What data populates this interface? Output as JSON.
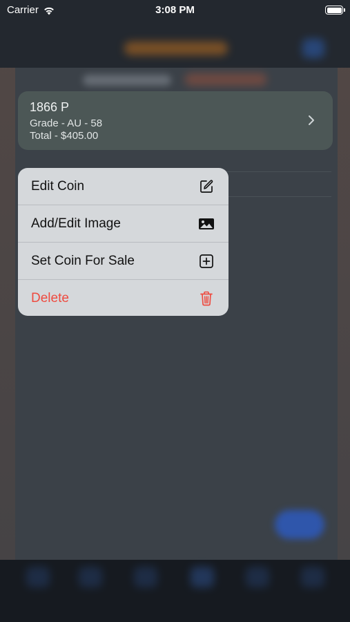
{
  "status_bar": {
    "carrier": "Carrier",
    "time": "3:08 PM",
    "wifi_icon": "wifi-icon",
    "battery_icon": "battery-icon"
  },
  "coin_card": {
    "title": "1866 P",
    "grade": "Grade - AU - 58",
    "total": "Total - $405.00",
    "chevron_icon": "chevron-right-icon"
  },
  "context_menu": {
    "items": [
      {
        "label": "Edit Coin",
        "icon": "edit-icon",
        "destructive": false
      },
      {
        "label": "Add/Edit Image",
        "icon": "image-icon",
        "destructive": false
      },
      {
        "label": "Set Coin For Sale",
        "icon": "plus-square-icon",
        "destructive": false
      },
      {
        "label": "Delete",
        "icon": "trash-icon",
        "destructive": true
      }
    ]
  },
  "colors": {
    "destructive": "#ee4b40",
    "menu_background": "#d5d8db",
    "card_background": "#4c5756",
    "dimmed_background": "#3b4148"
  }
}
